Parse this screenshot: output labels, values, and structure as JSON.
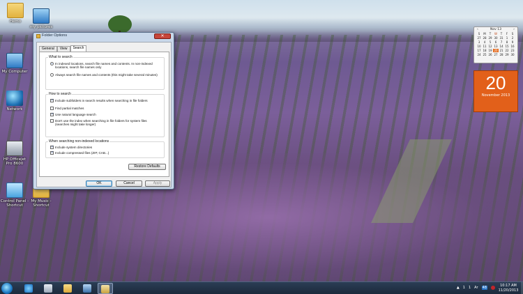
{
  "desktop": {
    "icons": [
      {
        "label": "Hemo"
      },
      {
        "label": "my pictures"
      },
      {
        "label": "My Computer"
      },
      {
        "label": "Network"
      },
      {
        "label": "HP Officejet Pro 8600"
      },
      {
        "label": ""
      },
      {
        "label": "Control Panel - Shortcut"
      },
      {
        "label": "My Music - Shortcut"
      }
    ]
  },
  "dialog": {
    "title": "Folder Options",
    "close": "✕",
    "tabs": [
      "General",
      "View",
      "Search"
    ],
    "active_tab": "Search",
    "what_to_search": {
      "label": "What to search",
      "opt1": "In indexed locations, search file names and contents. In non-indexed locations, search file names only",
      "opt2": "Always search file names and contents (this might take several minutes)"
    },
    "how_to_search": {
      "label": "How to search",
      "opt1": "Include subfolders in search results when searching in file folders",
      "opt2": "Find partial matches",
      "opt3": "Use natural language search",
      "opt4": "Don't use the index when searching in file folders for system files (searches might take longer)"
    },
    "non_indexed": {
      "label": "When searching non-indexed locations",
      "opt1": "Include system directories",
      "opt2": "Include compressed files (ZIP, CAB...)"
    },
    "buttons": {
      "restore": "Restore Defaults",
      "ok": "OK",
      "cancel": "Cancel",
      "apply": "Apply"
    }
  },
  "gadgets": {
    "calendar": {
      "month": "Nov 13",
      "days": [
        "S",
        "M",
        "T",
        "W",
        "T",
        "F",
        "S"
      ],
      "cells": [
        "27",
        "28",
        "29",
        "30",
        "31",
        "1",
        "2",
        "3",
        "4",
        "5",
        "6",
        "7",
        "8",
        "9",
        "10",
        "11",
        "12",
        "13",
        "14",
        "15",
        "16",
        "17",
        "18",
        "19",
        "20",
        "21",
        "22",
        "23",
        "24",
        "25",
        "26",
        "27",
        "28",
        "29",
        "30"
      ]
    },
    "date": {
      "day": "20",
      "month_year": "November 2013"
    }
  },
  "taskbar": {
    "tray": {
      "a": "▲",
      "b": "1",
      "c": "1",
      "d": "Ar",
      "num": "48"
    },
    "time": "10:17 AM",
    "date": "11/20/2013"
  }
}
